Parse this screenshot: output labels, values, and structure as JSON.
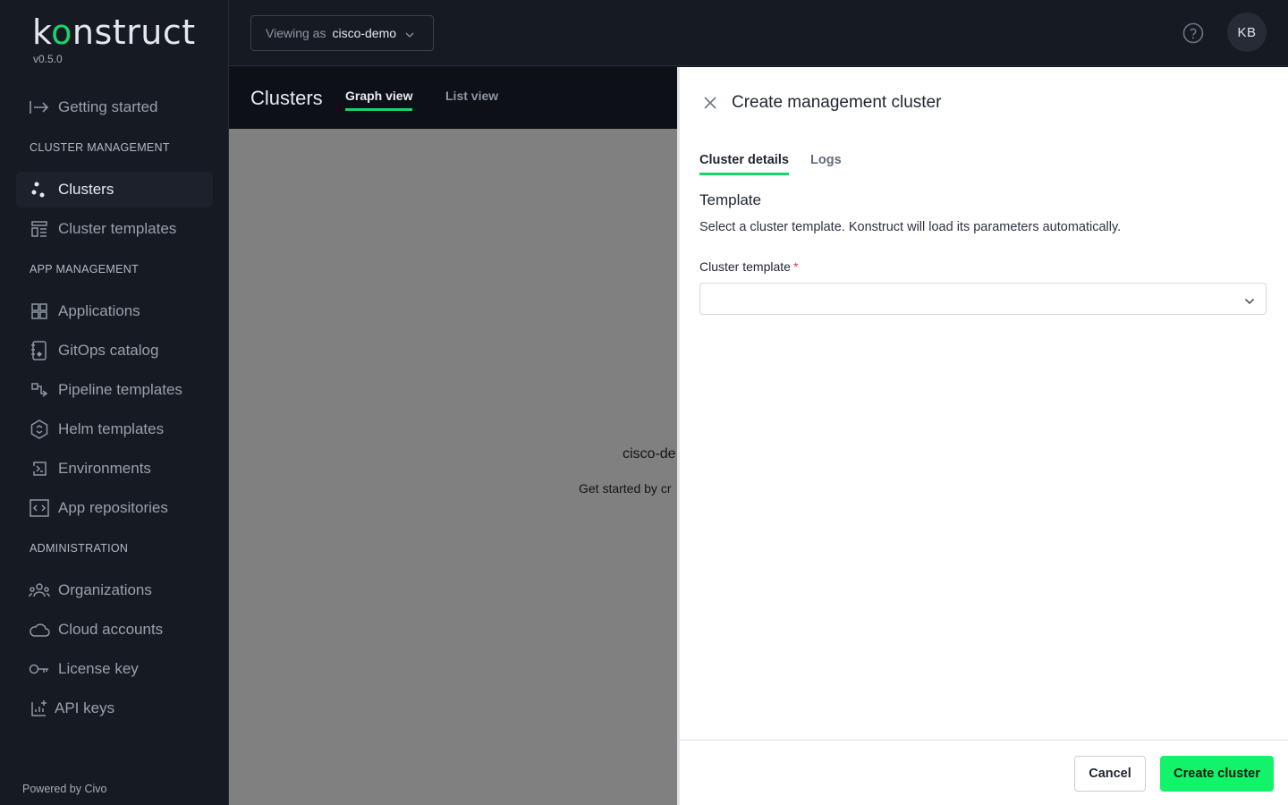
{
  "brand": {
    "logo_pre": "k",
    "logo_o": "o",
    "logo_post": "nstruct",
    "version": "v0.5.0",
    "accent": "#19d36b"
  },
  "sidebar": {
    "getting_started": "Getting started",
    "sections": {
      "cluster": "CLUSTER MANAGEMENT",
      "app": "APP MANAGEMENT",
      "admin": "ADMINISTRATION"
    },
    "items": {
      "clusters": "Clusters",
      "cluster_templates": "Cluster templates",
      "applications": "Applications",
      "gitops_catalog": "GitOps catalog",
      "pipeline_templates": "Pipeline templates",
      "helm_templates": "Helm templates",
      "environments": "Environments",
      "app_repositories": "App repositories",
      "organizations": "Organizations",
      "cloud_accounts": "Cloud accounts",
      "license_key": "License key",
      "api_keys": "API keys"
    },
    "powered_by": "Powered by Civo"
  },
  "topbar": {
    "viewing_label": "Viewing as",
    "viewing_org": "cisco-demo",
    "avatar_initials": "KB"
  },
  "page": {
    "title": "Clusters",
    "tabs": {
      "graph": "Graph view",
      "list": "List view"
    },
    "empty_title": "cisco-de",
    "empty_sub": "Get started by cr"
  },
  "drawer": {
    "title": "Create management cluster",
    "tabs": {
      "details": "Cluster details",
      "logs": "Logs"
    },
    "section_heading": "Template",
    "section_desc": "Select a cluster template. Konstruct will load its parameters automatically.",
    "field_label": "Cluster template",
    "required_mark": "*",
    "select_value": "",
    "cancel_label": "Cancel",
    "create_label": "Create cluster"
  }
}
